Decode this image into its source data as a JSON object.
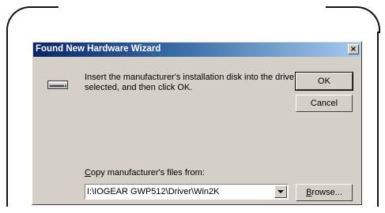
{
  "window": {
    "title": "Found New Hardware Wizard",
    "close_glyph": "×"
  },
  "message": "Insert the manufacturer's installation disk into the drive selected, and then click OK.",
  "buttons": {
    "ok": "OK",
    "cancel": "Cancel",
    "browse_first": "B",
    "browse_rest": "rowse..."
  },
  "copy_from": {
    "label_first": "C",
    "label_rest": "opy manufacturer's files from:",
    "value": "I:\\IOGEAR GWP512\\Driver\\Win2K"
  },
  "icons": {
    "disk": "floppy-drive-icon",
    "dropdown": "chevron-down-icon"
  },
  "colors": {
    "titlebar_start": "#0a246a",
    "titlebar_end": "#a6caf0",
    "dialog_bg": "#d4d0c8"
  }
}
